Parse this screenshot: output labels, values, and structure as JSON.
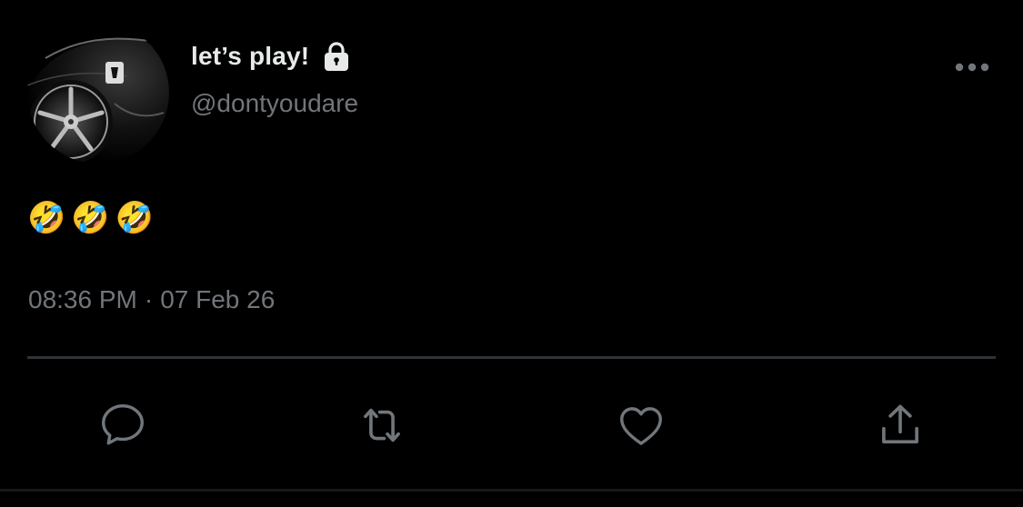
{
  "tweet": {
    "display_name": "let’s play!",
    "handle": "@dontyoudare",
    "text": "🤣🤣🤣",
    "time": "08:36 PM",
    "separator": "·",
    "date": "07 Feb 26"
  },
  "icons": {
    "lock": "lock-icon",
    "more": "more-horizontal-icon",
    "reply": "reply-icon",
    "retweet": "retweet-icon",
    "like": "heart-icon",
    "share": "share-icon"
  },
  "colors": {
    "background": "#000000",
    "primary_text": "#e7e9ea",
    "secondary_text": "#71767b",
    "icon": "#71767b",
    "divider": "#2f3336"
  }
}
